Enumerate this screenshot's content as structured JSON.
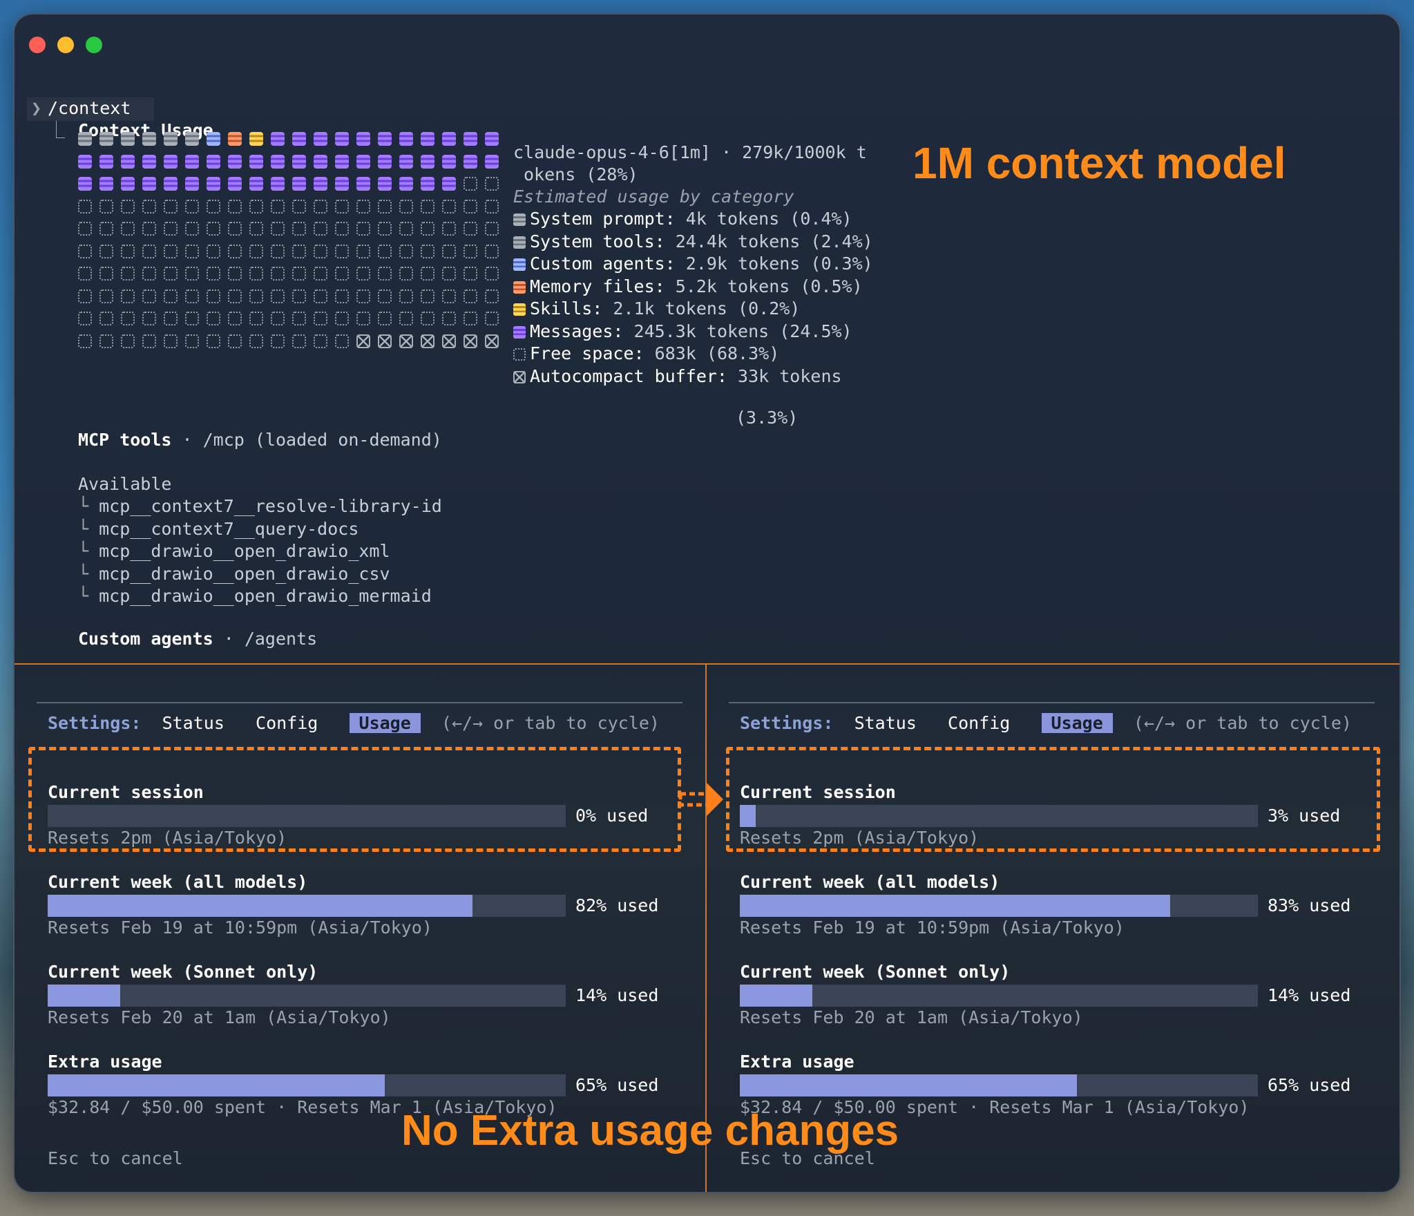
{
  "terminal": {
    "prompt_char": "❯",
    "command": "/context",
    "branch_char": "⎿",
    "heading": "Context Usage",
    "model_line_1": "claude-opus-4-6[1m] · 279k/1000k t",
    "model_line_2": "okens (28%)",
    "estimated_label": "Estimated usage by category",
    "categories": [
      {
        "label": "System prompt:",
        "value": "4k tokens (0.4%)"
      },
      {
        "label": "System tools:",
        "value": "24.4k tokens (2.4%)"
      },
      {
        "label": "Custom agents:",
        "value": "2.9k tokens (0.3%)"
      },
      {
        "label": "Memory files:",
        "value": "5.2k tokens (0.5%)"
      },
      {
        "label": "Skills:",
        "value": "2.1k tokens (0.2%)"
      },
      {
        "label": "Messages:",
        "value": "245.3k tokens (24.5%)"
      },
      {
        "label": "Free space:",
        "value": "683k (68.3%)"
      },
      {
        "label": "Autocompact buffer:",
        "value": "33k tokens"
      }
    ],
    "autocompact_pct": "(3.3%)",
    "mcp_title": "MCP tools",
    "mcp_sub": " · /mcp (loaded on-demand)",
    "available_label": "Available",
    "mcp_items": [
      "mcp__context7__resolve-library-id",
      "mcp__context7__query-docs",
      "mcp__drawio__open_drawio_xml",
      "mcp__drawio__open_drawio_csv",
      "mcp__drawio__open_drawio_mermaid"
    ],
    "agents_title": "Custom agents",
    "agents_sub": " · /agents"
  },
  "grid": {
    "cols": 20,
    "rows": 10,
    "row0": [
      "gray",
      "gray",
      "gray",
      "gray",
      "gray",
      "gray",
      "blue",
      "orange",
      "yellow",
      "purple",
      "purple",
      "purple",
      "purple",
      "purple",
      "purple",
      "purple",
      "purple",
      "purple",
      "purple",
      "purple"
    ],
    "purple_rows": 2,
    "purple_tail_count": 18,
    "buffer_cells": 7
  },
  "colors": {
    "accent_orange": "#ff8c1a",
    "bar_fill": "#8b97de",
    "bar_track": "#3b4356"
  },
  "panes": [
    {
      "settings_label": "Settings:",
      "tabs": [
        "Status",
        "Config",
        "Usage"
      ],
      "active_tab": "Usage",
      "hint": "(←/→ or tab to cycle)",
      "rows": [
        {
          "title": "Current session",
          "percent": 0,
          "used": "0% used",
          "reset": "Resets 2pm (Asia/Tokyo)"
        },
        {
          "title": "Current week (all models)",
          "percent": 82,
          "used": "82% used",
          "reset": "Resets Feb 19 at 10:59pm (Asia/Tokyo)"
        },
        {
          "title": "Current week (Sonnet only)",
          "percent": 14,
          "used": "14% used",
          "reset": "Resets Feb 20 at 1am (Asia/Tokyo)"
        },
        {
          "title": "Extra usage",
          "percent": 65,
          "used": "65% used",
          "reset": "$32.84 / $50.00 spent · Resets Mar 1 (Asia/Tokyo)"
        }
      ],
      "footer": "Esc to cancel"
    },
    {
      "settings_label": "Settings:",
      "tabs": [
        "Status",
        "Config",
        "Usage"
      ],
      "active_tab": "Usage",
      "hint": "(←/→ or tab to cycle)",
      "rows": [
        {
          "title": "Current session",
          "percent": 3,
          "used": "3% used",
          "reset": "Resets 2pm (Asia/Tokyo)"
        },
        {
          "title": "Current week (all models)",
          "percent": 83,
          "used": "83% used",
          "reset": "Resets Feb 19 at 10:59pm (Asia/Tokyo)"
        },
        {
          "title": "Current week (Sonnet only)",
          "percent": 14,
          "used": "14% used",
          "reset": "Resets Feb 20 at 1am (Asia/Tokyo)"
        },
        {
          "title": "Extra usage",
          "percent": 65,
          "used": "65% used",
          "reset": "$32.84 / $50.00 spent · Resets Mar 1 (Asia/Tokyo)"
        }
      ],
      "footer": "Esc to cancel"
    }
  ],
  "annotations": {
    "top_right": "1M context model",
    "bottom": "No Extra usage changes"
  }
}
